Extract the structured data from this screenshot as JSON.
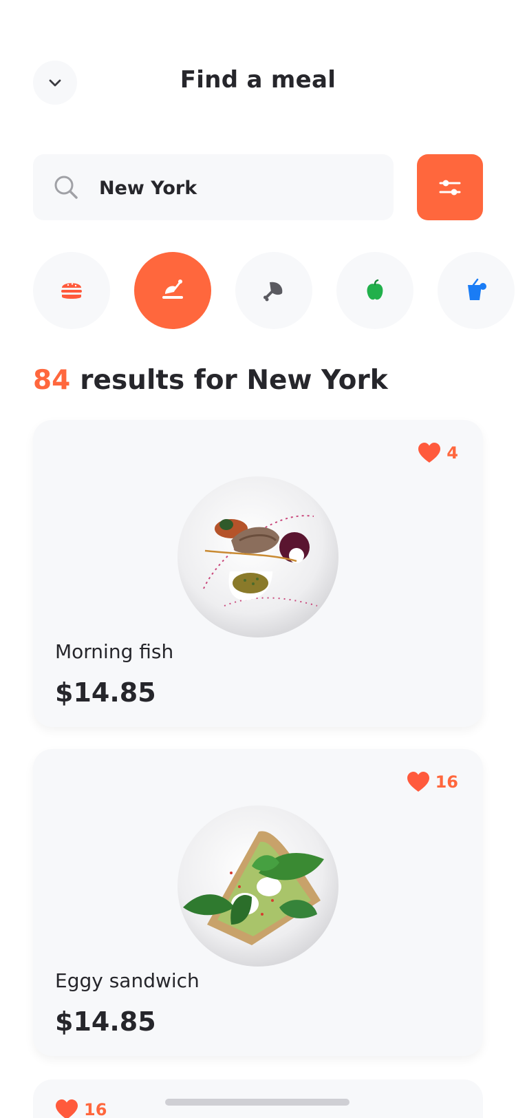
{
  "header": {
    "title": "Find a meal",
    "back_icon": "chevron-down-icon"
  },
  "search": {
    "value": "New York",
    "icon": "search-icon",
    "filter_icon": "sliders-icon"
  },
  "categories": [
    {
      "name": "burger",
      "icon": "burger-icon",
      "active": false,
      "color": "#ff5a3c"
    },
    {
      "name": "chicken",
      "icon": "chicken-leg-icon",
      "active": true,
      "color": "#ffffff"
    },
    {
      "name": "meat",
      "icon": "drumstick-icon",
      "active": false,
      "color": "#5a5a60"
    },
    {
      "name": "vegetable",
      "icon": "pepper-icon",
      "active": false,
      "color": "#21b04b"
    },
    {
      "name": "drinks",
      "icon": "drink-icon",
      "active": false,
      "color": "#1a7cf5"
    }
  ],
  "results": {
    "count": "84",
    "label": "results for New York"
  },
  "meals": [
    {
      "name": "Morning fish",
      "price": "$14.85",
      "likes": "4"
    },
    {
      "name": "Eggy sandwich",
      "price": "$14.85",
      "likes": "16"
    },
    {
      "name": "",
      "price": "",
      "likes": "16"
    }
  ],
  "colors": {
    "accent": "#ff673d",
    "text": "#26262b",
    "surface": "#f7f8fa"
  }
}
